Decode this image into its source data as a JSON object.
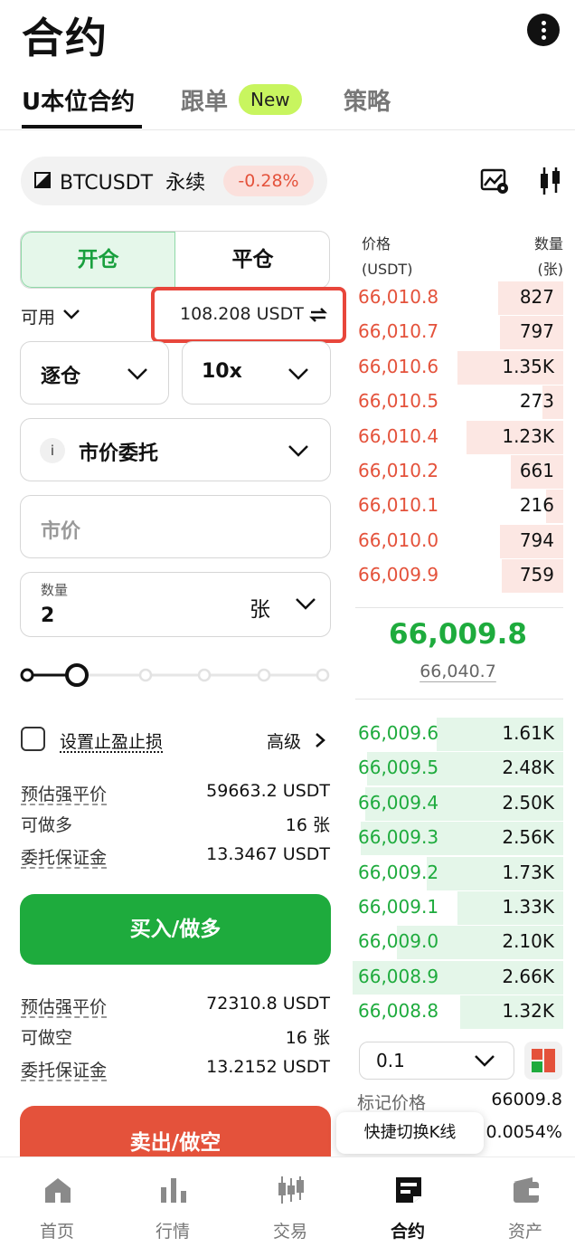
{
  "header": {
    "title": "合约",
    "more_icon": "more-vertical-icon"
  },
  "tabs": [
    {
      "label": "U本位合约",
      "active": true
    },
    {
      "label": "跟单",
      "badge": "New"
    },
    {
      "label": "策略"
    }
  ],
  "symbol": {
    "name": "BTCUSDT",
    "type": "永续",
    "change": "-0.28%"
  },
  "order_form": {
    "open_label": "开仓",
    "close_label": "平仓",
    "available_label": "可用",
    "available_value": "108.208 USDT",
    "margin_mode": "逐仓",
    "leverage": "10x",
    "order_type": "市价委托",
    "price_placeholder": "市价",
    "quantity_label": "数量",
    "quantity_value": "2",
    "quantity_unit": "张",
    "slider_level": 0.2,
    "tpsl_label": "设置止盈止损",
    "advanced_label": "高级"
  },
  "long_info": [
    {
      "label": "预估强平价",
      "value": "59663.2 USDT"
    },
    {
      "label": "可做多",
      "value": "16 张"
    },
    {
      "label": "委托保证金",
      "value": "13.3467 USDT"
    }
  ],
  "buy_label": "买入/做多",
  "short_info": [
    {
      "label": "预估强平价",
      "value": "72310.8 USDT"
    },
    {
      "label": "可做空",
      "value": "16 张"
    },
    {
      "label": "委托保证金",
      "value": "13.2152 USDT"
    }
  ],
  "sell_label": "卖出/做空",
  "orderbook": {
    "price_header": "价格",
    "price_unit": "(USDT)",
    "qty_header": "数量",
    "qty_unit": "(张)",
    "asks": [
      {
        "price": "66,010.8",
        "qty": "827",
        "depth": 0.31
      },
      {
        "price": "66,010.7",
        "qty": "797",
        "depth": 0.3
      },
      {
        "price": "66,010.6",
        "qty": "1.35K",
        "depth": 0.5
      },
      {
        "price": "66,010.5",
        "qty": "273",
        "depth": 0.1
      },
      {
        "price": "66,010.4",
        "qty": "1.23K",
        "depth": 0.46
      },
      {
        "price": "66,010.2",
        "qty": "661",
        "depth": 0.25
      },
      {
        "price": "66,010.1",
        "qty": "216",
        "depth": 0.08
      },
      {
        "price": "66,010.0",
        "qty": "794",
        "depth": 0.3
      },
      {
        "price": "66,009.9",
        "qty": "759",
        "depth": 0.29
      }
    ],
    "last_price": "66,009.8",
    "mark_price": "66,040.7",
    "bids": [
      {
        "price": "66,009.6",
        "qty": "1.61K",
        "depth": 0.6
      },
      {
        "price": "66,009.5",
        "qty": "2.48K",
        "depth": 0.93
      },
      {
        "price": "66,009.4",
        "qty": "2.50K",
        "depth": 0.94
      },
      {
        "price": "66,009.3",
        "qty": "2.56K",
        "depth": 0.96
      },
      {
        "price": "66,009.2",
        "qty": "1.73K",
        "depth": 0.65
      },
      {
        "price": "66,009.1",
        "qty": "1.33K",
        "depth": 0.5
      },
      {
        "price": "66,009.0",
        "qty": "2.10K",
        "depth": 0.79
      },
      {
        "price": "66,008.9",
        "qty": "2.66K",
        "depth": 1.0
      },
      {
        "price": "66,008.8",
        "qty": "1.32K",
        "depth": 0.49
      }
    ],
    "depth_step": "0.1",
    "mark_label": "标记价格",
    "mark_value": "66009.8",
    "funding_value": "0.0054%",
    "tooltip": "快捷切换K线"
  },
  "nav": [
    {
      "label": "首页",
      "icon": "home-icon"
    },
    {
      "label": "行情",
      "icon": "market-icon"
    },
    {
      "label": "交易",
      "icon": "trade-icon"
    },
    {
      "label": "合约",
      "icon": "futures-icon",
      "active": true
    },
    {
      "label": "资产",
      "icon": "wallet-icon"
    }
  ],
  "colors": {
    "green": "#1eab3d",
    "red": "#e4523b",
    "new_badge": "#c8f55f"
  }
}
